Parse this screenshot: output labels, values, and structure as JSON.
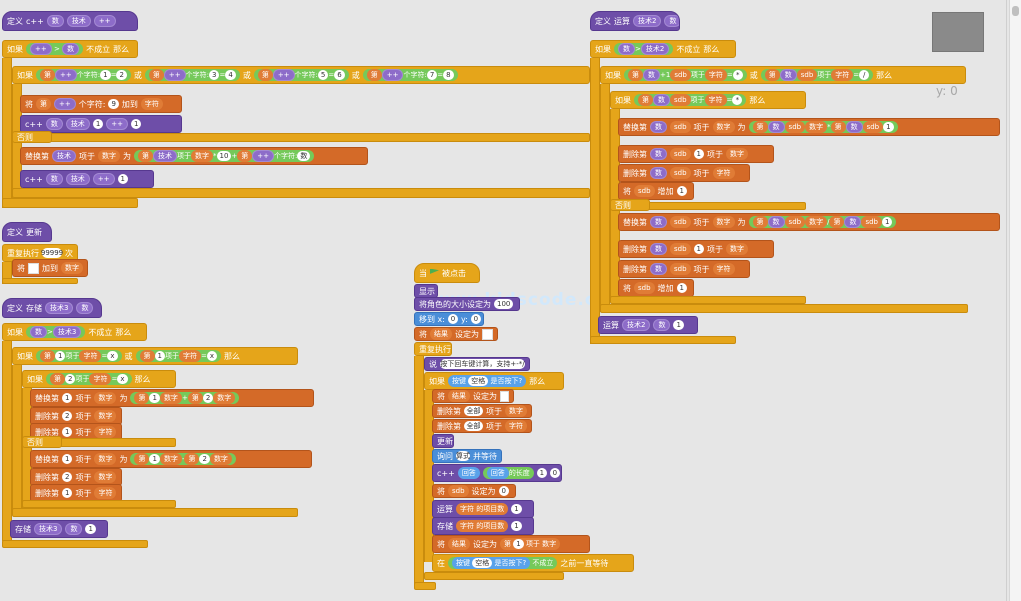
{
  "canvas": {
    "coord_readout": "y: 0",
    "watermark": "www.kidscode.cn"
  },
  "b1": {
    "define": "定义",
    "func": "c++",
    "p1": "数",
    "p2": "技术",
    "p3": "++",
    "if": "如果",
    "plus": "++",
    "gt": ">",
    "num": "数",
    "not_met": "不成立",
    "then": "那么",
    "cond_char": "第",
    "nth_char": "个字符:",
    "eq": "=",
    "or": "或",
    "n1": "1",
    "n2": "2",
    "n3": "3",
    "n4": "4",
    "n5": "5",
    "n6": "6",
    "n7": "7",
    "n8": "8",
    "n9": "9",
    "add_item": "将",
    "append": "加到",
    "to_list": "字符",
    "c_call": "c++",
    "skill": "技术",
    "plus_one": "+1",
    "else": "否则",
    "replace": "替换第",
    "item": "项于",
    "number": "数字",
    "as": "为",
    "mult": "*",
    "ten": "10",
    "add": "+"
  },
  "b2": {
    "define": "定义",
    "name": "更新",
    "repeat": "重复执行",
    "times_val": "99999",
    "times": "次",
    "set": "将",
    "add_to": "加到",
    "list": "数字"
  },
  "b3": {
    "define": "定义",
    "name": "存储",
    "p1": "技术3",
    "p2": "数",
    "if": "如果",
    "num": "数",
    "gt": ">",
    "v": "技术3",
    "not_met": "不成立",
    "then": "那么",
    "item1": "第",
    "one": "1",
    "of": "项于",
    "chars": "字符",
    "eq": "=",
    "x": "x",
    "two": "2",
    "replace": "替换第",
    "numbers": "数字",
    "as": "为",
    "plus": "+",
    "minus": "-",
    "del": "删除第",
    "of_list": "项于",
    "else": "否则",
    "store": "存储",
    "plus_one": "+1"
  },
  "b4": {
    "hat": "当",
    "clicked": "被点击",
    "show": "显示",
    "size": "将角色的大小设定为",
    "size_val": "100",
    "goto": "移到 x:",
    "x": "0",
    "y": "y:",
    "yv": "0",
    "set": "将",
    "var": "结果",
    "to": "设定为",
    "repeat_forever": "重复执行",
    "think": "说",
    "think_text": "按下回车键计算，支持+-*/",
    "think_secs": "",
    "if": "如果",
    "key": "按键",
    "space": "空格",
    "pressed": "是否按下?",
    "then": "那么",
    "set2": "将",
    "var2": "结果",
    "to2": "设定为",
    "del1": "删除第",
    "all": "全部",
    "of": "项于",
    "numbers": "数字",
    "del2": "删除第",
    "all2": "全部",
    "of2": "项于",
    "chars": "字符",
    "update": "更新",
    "ask": "询问",
    "ask_val": "算式",
    "wait": "并等待",
    "cpp": "c++",
    "answer": "回答",
    "length": "的长度",
    "n1": "1",
    "n0": "0",
    "set3": "将",
    "sdb": "sdb",
    "to3": "设定为",
    "v1": "0",
    "calc": "运算",
    "chars2": "字符",
    "items": "的项目数",
    "one": "1",
    "store": "存储",
    "chars3": "字符",
    "items2": "的项目数",
    "one2": "1",
    "set4": "将",
    "var4": "结果",
    "to4": "设定为",
    "item": "第",
    "of4": "项于",
    "nums": "数字",
    "wait_until": "在",
    "key2": "按键",
    "space2": "空格",
    "pressed2": "是否按下?",
    "not2": "不成立",
    "until": "之前一直等待"
  },
  "b5": {
    "define": "定义",
    "name": "运算",
    "p1": "技术2",
    "p2": "数",
    "if": "如果",
    "num": "数",
    "gt": ">",
    "v": "技术2",
    "not_met": "不成立",
    "then": "那么",
    "item": "第",
    "sdb": "sdb",
    "of": "项于",
    "chars": "字符",
    "eq": "=",
    "x": "*",
    "div": "/",
    "or": "或",
    "replace": "替换第",
    "numbers": "数字",
    "as": "为",
    "plus_one": "+1",
    "mult": "*",
    "del": "删除第",
    "set": "将",
    "incr": "增加",
    "one": "1",
    "else": "否则",
    "call": "运算",
    "call_arg": "技术2",
    "call_plus": "+1"
  }
}
